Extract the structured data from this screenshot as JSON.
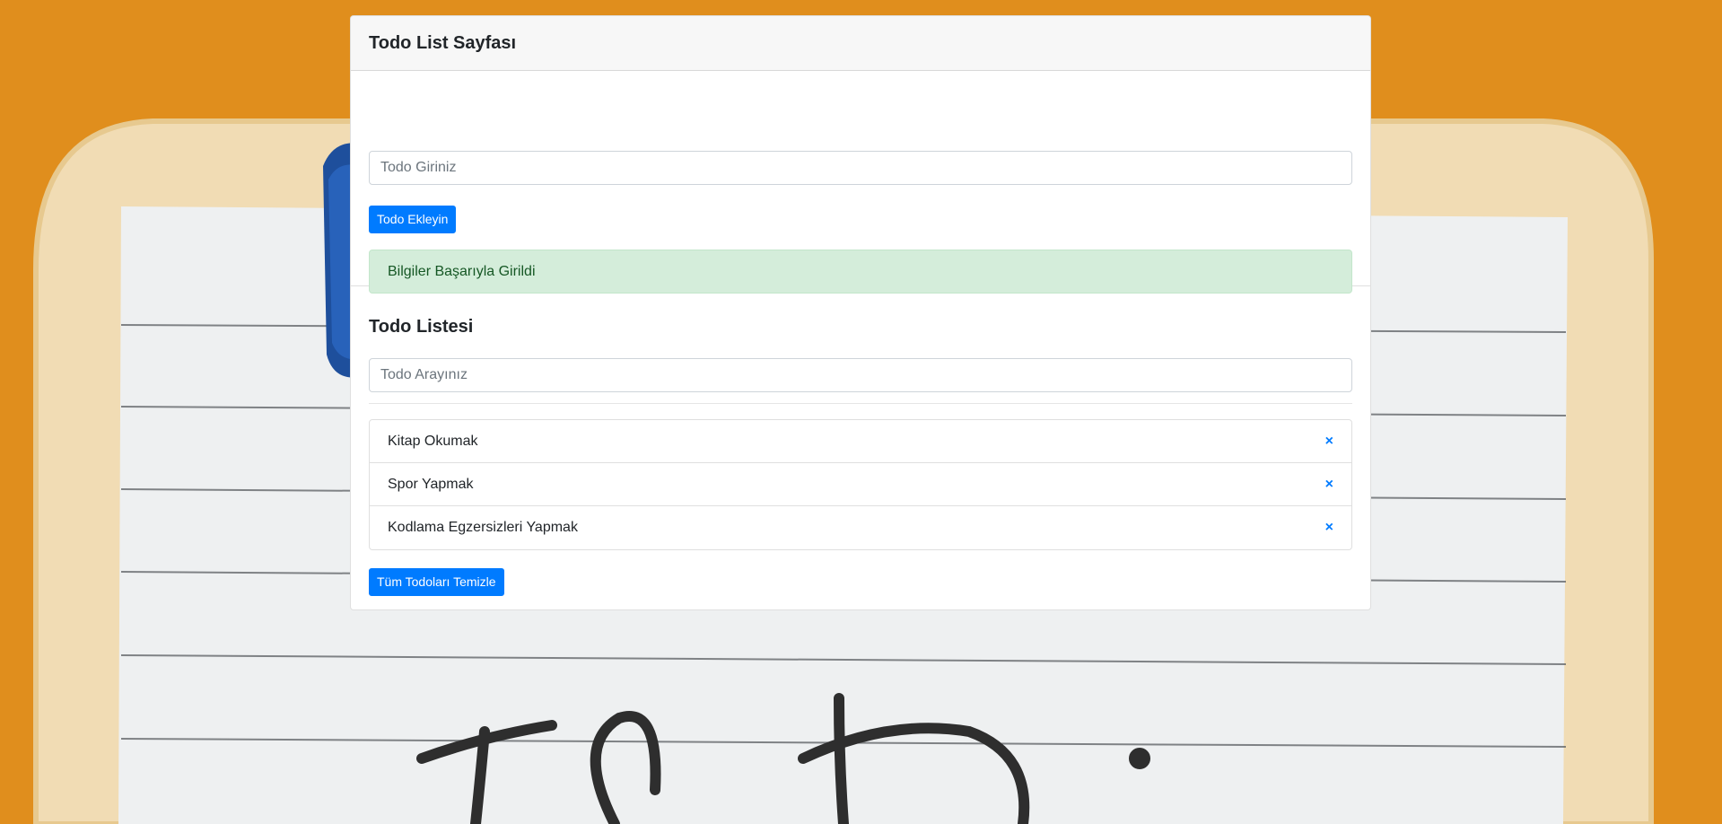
{
  "page": {
    "title": "Todo List Sayfası"
  },
  "add_form": {
    "input_placeholder": "Todo Giriniz",
    "input_value": "",
    "submit_label": "Todo Ekleyin",
    "alert_text": "Bilgiler Başarıyla Girildi"
  },
  "todo_list": {
    "title": "Todo Listesi",
    "search_placeholder": "Todo Arayınız",
    "search_value": "",
    "items": [
      {
        "label": "Kitap Okumak",
        "delete_icon": "×"
      },
      {
        "label": "Spor Yapmak",
        "delete_icon": "×"
      },
      {
        "label": "Kodlama Egzersizleri Yapmak",
        "delete_icon": "×"
      }
    ],
    "clear_label": "Tüm Todoları Temizle"
  },
  "colors": {
    "background": "#e3911e",
    "primary": "#007bff",
    "success_bg": "#d4edda",
    "success_text": "#155724"
  }
}
